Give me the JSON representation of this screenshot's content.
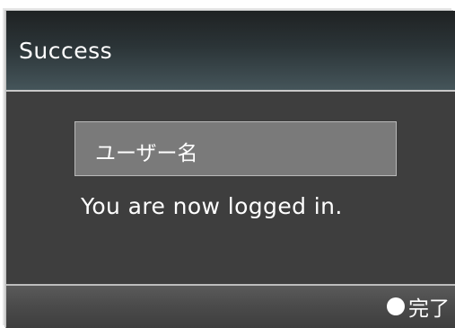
{
  "dialog": {
    "title": "Success",
    "username_field": "ユーザー名",
    "message": "You are now logged in.",
    "footer": {
      "done_icon": "circle-icon",
      "done_label": "完了"
    }
  }
}
